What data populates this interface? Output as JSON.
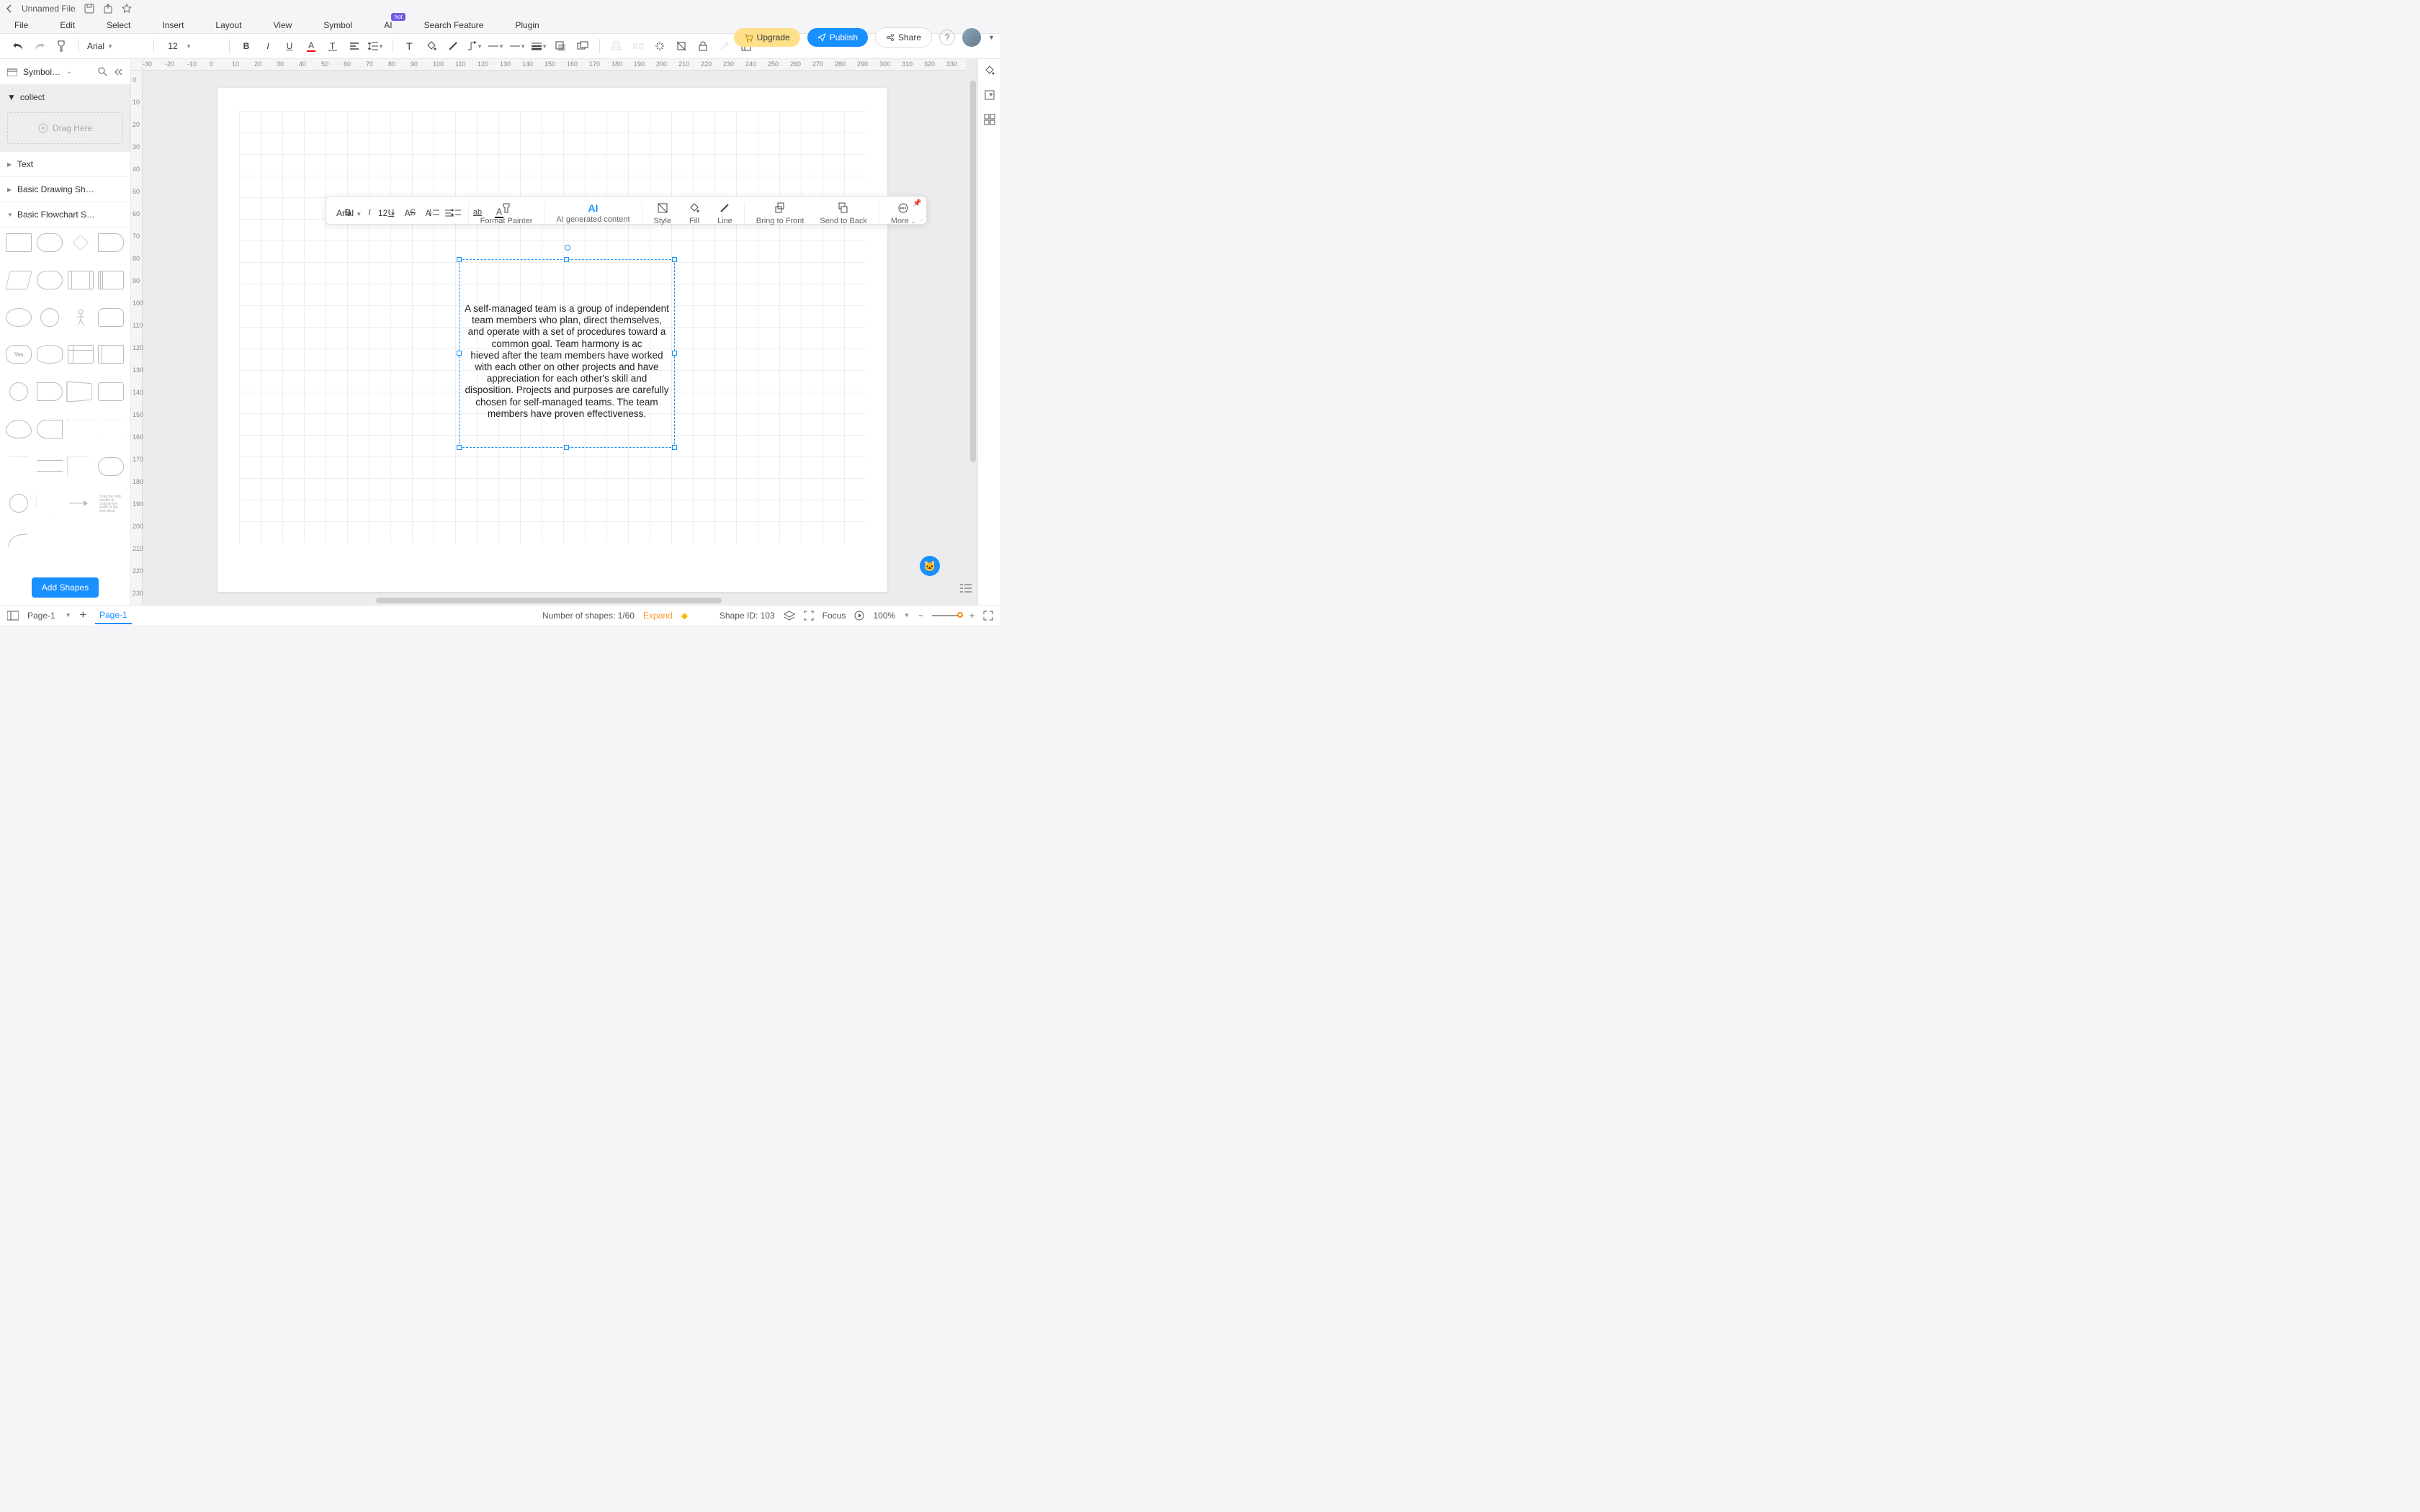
{
  "title": {
    "filename": "Unnamed File"
  },
  "menu": {
    "items": [
      "File",
      "Edit",
      "Select",
      "Insert",
      "Layout",
      "View",
      "Symbol",
      "AI",
      "Search Feature",
      "Plugin"
    ],
    "ai_badge": "hot"
  },
  "topright": {
    "upgrade": "Upgrade",
    "publish": "Publish",
    "share": "Share"
  },
  "toolbar": {
    "font": "Arial",
    "size": "12"
  },
  "sidebar": {
    "library_label": "Symbol…",
    "collect": "collect",
    "drag_here": "Drag Here",
    "sections": {
      "text": "Text",
      "basic_drawing": "Basic Drawing Sh…",
      "basic_flowchart": "Basic Flowchart S…"
    },
    "yes_shape": "Yes",
    "add_shapes": "Add Shapes"
  },
  "ruler_h": [
    "-30",
    "-20",
    "-10",
    "0",
    "10",
    "20",
    "30",
    "40",
    "50",
    "60",
    "70",
    "80",
    "90",
    "100",
    "110",
    "120",
    "130",
    "140",
    "150",
    "160",
    "170",
    "180",
    "190",
    "200",
    "210",
    "220",
    "230",
    "240",
    "250",
    "260",
    "270",
    "280",
    "290",
    "300",
    "310",
    "320",
    "330"
  ],
  "ruler_v": [
    "0",
    "10",
    "20",
    "30",
    "40",
    "50",
    "60",
    "70",
    "80",
    "90",
    "100",
    "110",
    "120",
    "130",
    "140",
    "150",
    "160",
    "170",
    "180",
    "190",
    "200",
    "210",
    "220",
    "230"
  ],
  "ctx": {
    "font": "Arial",
    "size": "12",
    "format_painter": "Format Painter",
    "ai_generated": "AI generated content",
    "style": "Style",
    "fill": "Fill",
    "line": "Line",
    "bring_front": "Bring to Front",
    "send_back": "Send to Back",
    "more": "More"
  },
  "textbox": {
    "content": "A self-managed team is a group of independent team members who plan, direct themselves, and operate with a set of procedures toward a common goal. Team harmony is ac\nhieved after the team members have worked with each other on other projects and have appreciation for each other's skill and disposition. Projects and purposes are carefully chosen for self-managed teams. The team members have proven effectiveness."
  },
  "status": {
    "page_label": "Page-1",
    "page_tab": "Page-1",
    "shapes_count": "Number of shapes: 1/60",
    "expand": "Expand",
    "shape_id": "Shape ID: 103",
    "focus": "Focus",
    "zoom": "100%"
  }
}
